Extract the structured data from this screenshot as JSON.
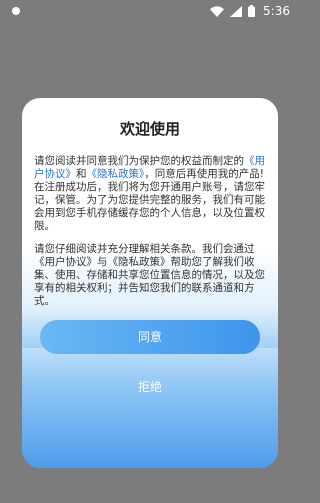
{
  "status_bar": {
    "time": "5:36"
  },
  "dialog": {
    "title": "欢迎使用",
    "para1": {
      "prefix": "请您阅读并同意我们为保护您的权益而制定的",
      "user_agreement": "《用户协议》",
      "and": "和",
      "privacy_policy": "《隐私政策》",
      "suffix": "，同意后再使用我的产品!在注册成功后，我们将为您开通用户账号，请您牢记，保管。为了为您提供完整的服务，我们有可能会用到您手机存储缓存您的个人信息，以及位置权限。"
    },
    "para2": "请您仔细阅读并充分理解相关条款。我们会通过《用户协议》与《隐私政策》帮助您了解我们收集、使用、存储和共享您位置信息的情况，以及您享有的相关权利；并告知您我们的联系通道和方式。",
    "agree_label": "同意",
    "reject_label": "拒绝"
  },
  "colors": {
    "link": "#2a73d9",
    "button": "#3d95ec",
    "overlay": "#7c7c7c"
  }
}
